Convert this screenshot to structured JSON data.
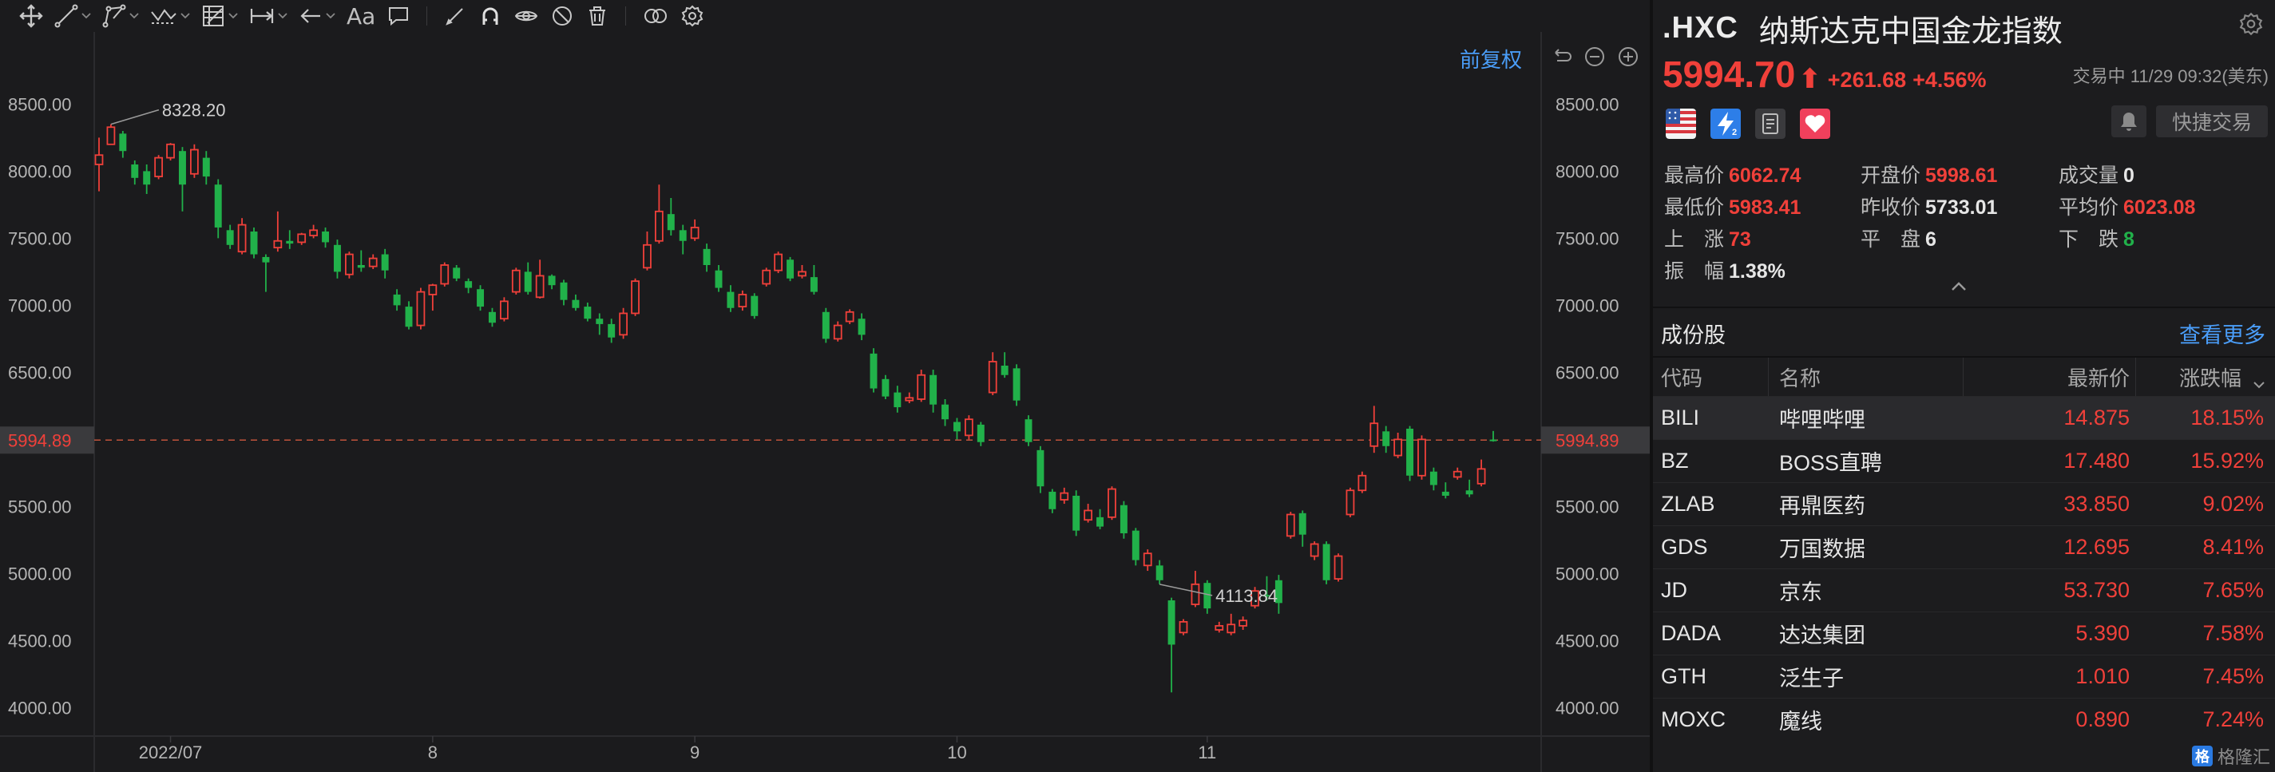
{
  "toolbar": {
    "tools": [
      "crosshair-icon",
      "trend-line-icon",
      "polyline-icon",
      "wave-icon",
      "ruler-icon",
      "measure-icon",
      "arrow-left-icon",
      "text-tool-icon",
      "comment-icon",
      "pen-icon",
      "magnet-icon",
      "eye-icon",
      "hide-icon",
      "trash-icon",
      "compare-icon",
      "settings-icon"
    ],
    "text_tool_label": "Aa"
  },
  "chart_controls": {
    "adjust_label": "前复权"
  },
  "quote": {
    "code": ".HXC",
    "name": "纳斯达克中国金龙指数",
    "price": "5994.70",
    "arrow": "⬆",
    "change": "+261.68",
    "change_pct": "+4.56%",
    "status": "交易中 11/29 09:32(美东)",
    "quick_trade_label": "快捷交易",
    "market_icons": [
      "us-flag-icon",
      "lightning-icon",
      "document-icon",
      "heart-icon"
    ]
  },
  "stats": {
    "high": {
      "label": "最高价",
      "value": "6062.74"
    },
    "open": {
      "label": "开盘价",
      "value": "5998.61"
    },
    "volume": {
      "label": "成交量",
      "value": "0"
    },
    "low": {
      "label": "最低价",
      "value": "5983.41"
    },
    "prev_close": {
      "label": "昨收价",
      "value": "5733.01"
    },
    "avg": {
      "label": "平均价",
      "value": "6023.08"
    },
    "up": {
      "label": "上　涨",
      "value": "73"
    },
    "flat": {
      "label": "平　盘",
      "value": "6"
    },
    "down": {
      "label": "下　跌",
      "value": "8"
    },
    "amplitude": {
      "label": "振　幅",
      "value": "1.38%"
    }
  },
  "constituents": {
    "title": "成份股",
    "more_label": "查看更多",
    "headers": {
      "code": "代码",
      "name": "名称",
      "price": "最新价",
      "pct": "涨跌幅"
    },
    "rows": [
      {
        "code": "BILI",
        "name": "哔哩哔哩",
        "price": "14.875",
        "pct": "18.15%"
      },
      {
        "code": "BZ",
        "name": "BOSS直聘",
        "price": "17.480",
        "pct": "15.92%"
      },
      {
        "code": "ZLAB",
        "name": "再鼎医药",
        "price": "33.850",
        "pct": "9.02%"
      },
      {
        "code": "GDS",
        "name": "万国数据",
        "price": "12.695",
        "pct": "8.41%"
      },
      {
        "code": "JD",
        "name": "京东",
        "price": "53.730",
        "pct": "7.65%"
      },
      {
        "code": "DADA",
        "name": "达达集团",
        "price": "5.390",
        "pct": "7.58%"
      },
      {
        "code": "GTH",
        "name": "泛生子",
        "price": "1.010",
        "pct": "7.45%"
      },
      {
        "code": "MOXC",
        "name": "魔线",
        "price": "0.890",
        "pct": "7.24%"
      }
    ]
  },
  "watermark": "格隆汇",
  "colors": {
    "up": "#f0403a",
    "down": "#21b14a",
    "accent": "#4a9df8"
  },
  "chart_data": {
    "type": "candlestick",
    "ylim": [
      3800,
      8800
    ],
    "yticks": [
      8500,
      8000,
      7500,
      7000,
      6500,
      6000,
      5500,
      5000,
      4500,
      4000
    ],
    "ytick_labels": [
      "8500.00",
      "8000.00",
      "7500.00",
      "7000.00",
      "6500.00",
      "6000.00",
      "5500.00",
      "5000.00",
      "4500.00",
      "4000.00"
    ],
    "xticks": [
      {
        "label": "2022/07",
        "index": 6
      },
      {
        "label": "8",
        "index": 28
      },
      {
        "label": "9",
        "index": 50
      },
      {
        "label": "10",
        "index": 72
      },
      {
        "label": "11",
        "index": 93
      }
    ],
    "current_price": 5994.89,
    "current_price_label": "5994.89",
    "max_label": "8328.20",
    "min_label": "4113.84",
    "max_index": 1,
    "min_index": 89,
    "candles": [
      [
        8050,
        8120,
        7850,
        8250
      ],
      [
        8200,
        8328.2,
        8200,
        8350
      ],
      [
        8280,
        8150,
        8100,
        8300
      ],
      [
        8050,
        7950,
        7900,
        8080
      ],
      [
        8000,
        7900,
        7830,
        8050
      ],
      [
        7960,
        8100,
        7940,
        8120
      ],
      [
        8100,
        8200,
        8080,
        8210
      ],
      [
        8150,
        7900,
        7700,
        8180
      ],
      [
        7980,
        8160,
        7950,
        8200
      ],
      [
        8100,
        7960,
        7900,
        8150
      ],
      [
        7900,
        7580,
        7500,
        7940
      ],
      [
        7560,
        7450,
        7420,
        7600
      ],
      [
        7400,
        7600,
        7380,
        7650
      ],
      [
        7550,
        7380,
        7350,
        7580
      ],
      [
        7360,
        7320,
        7100,
        7380
      ],
      [
        7430,
        7480,
        7400,
        7700
      ],
      [
        7480,
        7460,
        7420,
        7560
      ],
      [
        7470,
        7530,
        7450,
        7540
      ],
      [
        7520,
        7560,
        7500,
        7600
      ],
      [
        7550,
        7470,
        7430,
        7580
      ],
      [
        7450,
        7250,
        7200,
        7490
      ],
      [
        7230,
        7380,
        7200,
        7400
      ],
      [
        7300,
        7280,
        7250,
        7410
      ],
      [
        7290,
        7350,
        7270,
        7380
      ],
      [
        7380,
        7260,
        7200,
        7420
      ],
      [
        7080,
        7000,
        6960,
        7120
      ],
      [
        6990,
        6840,
        6820,
        7030
      ],
      [
        6850,
        7100,
        6820,
        7130
      ],
      [
        7080,
        7150,
        6960,
        7160
      ],
      [
        7160,
        7300,
        7140,
        7320
      ],
      [
        7280,
        7200,
        7180,
        7300
      ],
      [
        7180,
        7130,
        7090,
        7200
      ],
      [
        7120,
        6990,
        6960,
        7150
      ],
      [
        6950,
        6870,
        6840,
        6980
      ],
      [
        6900,
        7030,
        6880,
        7060
      ],
      [
        7100,
        7260,
        7080,
        7280
      ],
      [
        7250,
        7100,
        7080,
        7320
      ],
      [
        7060,
        7220,
        7050,
        7340
      ],
      [
        7220,
        7150,
        7120,
        7230
      ],
      [
        7170,
        7040,
        7000,
        7190
      ],
      [
        7040,
        6980,
        6960,
        7080
      ],
      [
        6990,
        6900,
        6880,
        7020
      ],
      [
        6900,
        6860,
        6780,
        6940
      ],
      [
        6860,
        6760,
        6720,
        6900
      ],
      [
        6780,
        6940,
        6750,
        6980
      ],
      [
        6940,
        7180,
        6920,
        7200
      ],
      [
        7280,
        7450,
        7260,
        7550
      ],
      [
        7480,
        7700,
        7460,
        7900
      ],
      [
        7680,
        7560,
        7520,
        7800
      ],
      [
        7560,
        7480,
        7380,
        7600
      ],
      [
        7500,
        7580,
        7480,
        7640
      ],
      [
        7420,
        7300,
        7250,
        7460
      ],
      [
        7260,
        7130,
        7100,
        7300
      ],
      [
        7100,
        6980,
        6950,
        7150
      ],
      [
        6990,
        7080,
        6960,
        7110
      ],
      [
        7070,
        6920,
        6900,
        7090
      ],
      [
        7160,
        7260,
        7140,
        7280
      ],
      [
        7260,
        7380,
        7240,
        7400
      ],
      [
        7340,
        7200,
        7180,
        7360
      ],
      [
        7220,
        7250,
        7200,
        7300
      ],
      [
        7210,
        7100,
        7080,
        7300
      ],
      [
        6950,
        6750,
        6720,
        6980
      ],
      [
        6750,
        6850,
        6730,
        6880
      ],
      [
        6880,
        6950,
        6860,
        6970
      ],
      [
        6900,
        6780,
        6740,
        6940
      ],
      [
        6640,
        6380,
        6350,
        6680
      ],
      [
        6450,
        6320,
        6300,
        6480
      ],
      [
        6350,
        6240,
        6200,
        6400
      ],
      [
        6290,
        6310,
        6270,
        6350
      ],
      [
        6300,
        6480,
        6280,
        6520
      ],
      [
        6480,
        6260,
        6200,
        6520
      ],
      [
        6260,
        6150,
        6100,
        6300
      ],
      [
        6130,
        6060,
        6000,
        6160
      ],
      [
        6030,
        6150,
        6000,
        6180
      ],
      [
        6110,
        5980,
        5950,
        6130
      ],
      [
        6350,
        6580,
        6330,
        6650
      ],
      [
        6550,
        6480,
        6460,
        6650
      ],
      [
        6530,
        6290,
        6250,
        6560
      ],
      [
        6150,
        5980,
        5950,
        6180
      ],
      [
        5920,
        5650,
        5600,
        5950
      ],
      [
        5610,
        5480,
        5450,
        5630
      ],
      [
        5550,
        5600,
        5520,
        5640
      ],
      [
        5580,
        5320,
        5280,
        5620
      ],
      [
        5400,
        5470,
        5380,
        5520
      ],
      [
        5420,
        5350,
        5330,
        5480
      ],
      [
        5420,
        5630,
        5400,
        5650
      ],
      [
        5510,
        5300,
        5260,
        5540
      ],
      [
        5320,
        5100,
        5060,
        5340
      ],
      [
        5060,
        5150,
        5020,
        5180
      ],
      [
        5060,
        4950,
        4920,
        5100
      ],
      [
        4800,
        4470,
        4113.84,
        4820
      ],
      [
        4560,
        4640,
        4540,
        4660
      ],
      [
        4770,
        4920,
        4750,
        5020
      ],
      [
        4930,
        4740,
        4700,
        4950
      ],
      [
        4580,
        4610,
        4560,
        4640
      ],
      [
        4560,
        4620,
        4540,
        4700
      ],
      [
        4610,
        4650,
        4580,
        4680
      ],
      [
        4760,
        4870,
        4740,
        4900
      ],
      [
        4840,
        4830,
        4800,
        4980
      ],
      [
        4950,
        4780,
        4700,
        4990
      ],
      [
        5280,
        5440,
        5260,
        5460
      ],
      [
        5450,
        5290,
        5200,
        5470
      ],
      [
        5130,
        5220,
        5100,
        5240
      ],
      [
        5220,
        4950,
        4920,
        5240
      ],
      [
        4960,
        5130,
        4940,
        5150
      ],
      [
        5440,
        5620,
        5420,
        5640
      ],
      [
        5620,
        5730,
        5600,
        5760
      ],
      [
        5950,
        6120,
        5900,
        6250
      ],
      [
        6060,
        5950,
        5900,
        6100
      ],
      [
        5880,
        6000,
        5860,
        6050
      ],
      [
        6080,
        5730,
        5690,
        6100
      ],
      [
        5730,
        6000,
        5700,
        6030
      ],
      [
        5760,
        5660,
        5620,
        5790
      ],
      [
        5610,
        5580,
        5560,
        5680
      ],
      [
        5720,
        5760,
        5700,
        5790
      ],
      [
        5620,
        5590,
        5570,
        5700
      ],
      [
        5670,
        5780,
        5650,
        5850
      ],
      [
        5998.61,
        5994.7,
        5983.41,
        6062.74
      ]
    ]
  }
}
